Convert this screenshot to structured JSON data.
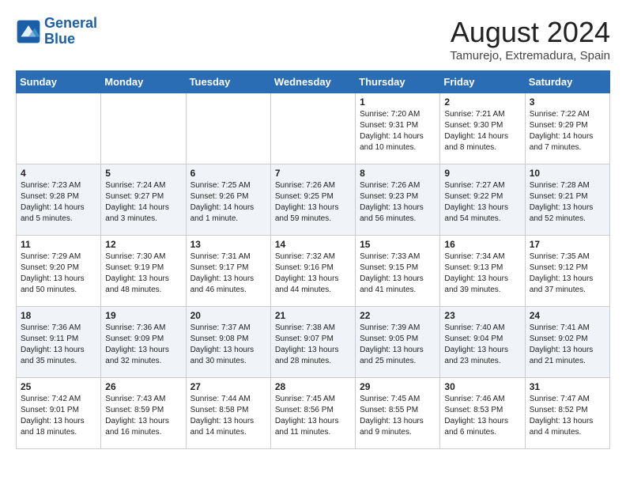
{
  "logo": {
    "line1": "General",
    "line2": "Blue"
  },
  "title": "August 2024",
  "location": "Tamurejo, Extremadura, Spain",
  "days_of_week": [
    "Sunday",
    "Monday",
    "Tuesday",
    "Wednesday",
    "Thursday",
    "Friday",
    "Saturday"
  ],
  "weeks": [
    [
      {
        "num": "",
        "info": ""
      },
      {
        "num": "",
        "info": ""
      },
      {
        "num": "",
        "info": ""
      },
      {
        "num": "",
        "info": ""
      },
      {
        "num": "1",
        "info": "Sunrise: 7:20 AM\nSunset: 9:31 PM\nDaylight: 14 hours\nand 10 minutes."
      },
      {
        "num": "2",
        "info": "Sunrise: 7:21 AM\nSunset: 9:30 PM\nDaylight: 14 hours\nand 8 minutes."
      },
      {
        "num": "3",
        "info": "Sunrise: 7:22 AM\nSunset: 9:29 PM\nDaylight: 14 hours\nand 7 minutes."
      }
    ],
    [
      {
        "num": "4",
        "info": "Sunrise: 7:23 AM\nSunset: 9:28 PM\nDaylight: 14 hours\nand 5 minutes."
      },
      {
        "num": "5",
        "info": "Sunrise: 7:24 AM\nSunset: 9:27 PM\nDaylight: 14 hours\nand 3 minutes."
      },
      {
        "num": "6",
        "info": "Sunrise: 7:25 AM\nSunset: 9:26 PM\nDaylight: 14 hours\nand 1 minute."
      },
      {
        "num": "7",
        "info": "Sunrise: 7:26 AM\nSunset: 9:25 PM\nDaylight: 13 hours\nand 59 minutes."
      },
      {
        "num": "8",
        "info": "Sunrise: 7:26 AM\nSunset: 9:23 PM\nDaylight: 13 hours\nand 56 minutes."
      },
      {
        "num": "9",
        "info": "Sunrise: 7:27 AM\nSunset: 9:22 PM\nDaylight: 13 hours\nand 54 minutes."
      },
      {
        "num": "10",
        "info": "Sunrise: 7:28 AM\nSunset: 9:21 PM\nDaylight: 13 hours\nand 52 minutes."
      }
    ],
    [
      {
        "num": "11",
        "info": "Sunrise: 7:29 AM\nSunset: 9:20 PM\nDaylight: 13 hours\nand 50 minutes."
      },
      {
        "num": "12",
        "info": "Sunrise: 7:30 AM\nSunset: 9:19 PM\nDaylight: 13 hours\nand 48 minutes."
      },
      {
        "num": "13",
        "info": "Sunrise: 7:31 AM\nSunset: 9:17 PM\nDaylight: 13 hours\nand 46 minutes."
      },
      {
        "num": "14",
        "info": "Sunrise: 7:32 AM\nSunset: 9:16 PM\nDaylight: 13 hours\nand 44 minutes."
      },
      {
        "num": "15",
        "info": "Sunrise: 7:33 AM\nSunset: 9:15 PM\nDaylight: 13 hours\nand 41 minutes."
      },
      {
        "num": "16",
        "info": "Sunrise: 7:34 AM\nSunset: 9:13 PM\nDaylight: 13 hours\nand 39 minutes."
      },
      {
        "num": "17",
        "info": "Sunrise: 7:35 AM\nSunset: 9:12 PM\nDaylight: 13 hours\nand 37 minutes."
      }
    ],
    [
      {
        "num": "18",
        "info": "Sunrise: 7:36 AM\nSunset: 9:11 PM\nDaylight: 13 hours\nand 35 minutes."
      },
      {
        "num": "19",
        "info": "Sunrise: 7:36 AM\nSunset: 9:09 PM\nDaylight: 13 hours\nand 32 minutes."
      },
      {
        "num": "20",
        "info": "Sunrise: 7:37 AM\nSunset: 9:08 PM\nDaylight: 13 hours\nand 30 minutes."
      },
      {
        "num": "21",
        "info": "Sunrise: 7:38 AM\nSunset: 9:07 PM\nDaylight: 13 hours\nand 28 minutes."
      },
      {
        "num": "22",
        "info": "Sunrise: 7:39 AM\nSunset: 9:05 PM\nDaylight: 13 hours\nand 25 minutes."
      },
      {
        "num": "23",
        "info": "Sunrise: 7:40 AM\nSunset: 9:04 PM\nDaylight: 13 hours\nand 23 minutes."
      },
      {
        "num": "24",
        "info": "Sunrise: 7:41 AM\nSunset: 9:02 PM\nDaylight: 13 hours\nand 21 minutes."
      }
    ],
    [
      {
        "num": "25",
        "info": "Sunrise: 7:42 AM\nSunset: 9:01 PM\nDaylight: 13 hours\nand 18 minutes."
      },
      {
        "num": "26",
        "info": "Sunrise: 7:43 AM\nSunset: 8:59 PM\nDaylight: 13 hours\nand 16 minutes."
      },
      {
        "num": "27",
        "info": "Sunrise: 7:44 AM\nSunset: 8:58 PM\nDaylight: 13 hours\nand 14 minutes."
      },
      {
        "num": "28",
        "info": "Sunrise: 7:45 AM\nSunset: 8:56 PM\nDaylight: 13 hours\nand 11 minutes."
      },
      {
        "num": "29",
        "info": "Sunrise: 7:45 AM\nSunset: 8:55 PM\nDaylight: 13 hours\nand 9 minutes."
      },
      {
        "num": "30",
        "info": "Sunrise: 7:46 AM\nSunset: 8:53 PM\nDaylight: 13 hours\nand 6 minutes."
      },
      {
        "num": "31",
        "info": "Sunrise: 7:47 AM\nSunset: 8:52 PM\nDaylight: 13 hours\nand 4 minutes."
      }
    ]
  ]
}
